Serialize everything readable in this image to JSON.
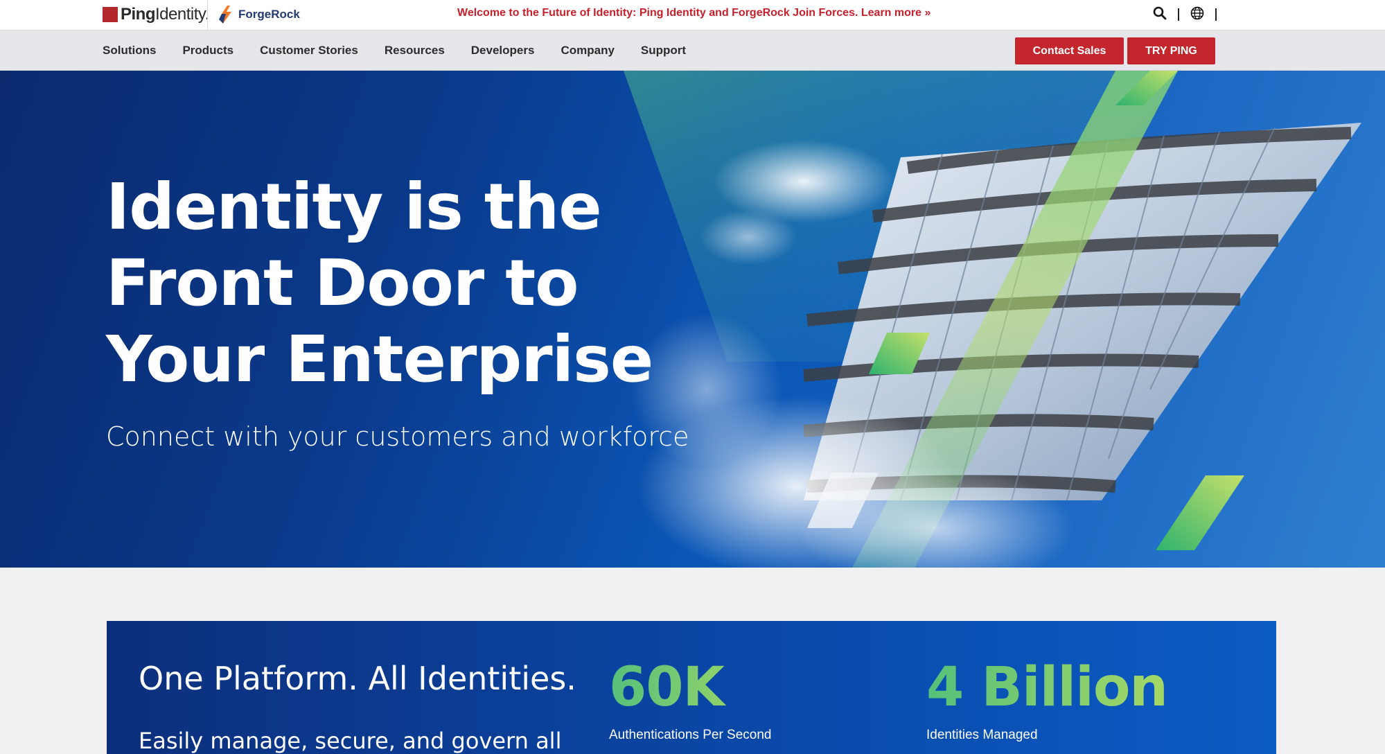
{
  "topbar": {
    "ping_logo_bold": "Ping",
    "ping_logo_light": "Identity.",
    "forgerock_logo": "ForgeRock",
    "announcement_text": "Welcome to the Future of Identity: Ping Identity and ForgeRock Join Forces.",
    "announcement_link": "Learn more »",
    "icons": [
      "search-icon",
      "globe-icon"
    ]
  },
  "nav": {
    "items": [
      {
        "label": "Solutions"
      },
      {
        "label": "Products"
      },
      {
        "label": "Customer Stories"
      },
      {
        "label": "Resources"
      },
      {
        "label": "Developers"
      },
      {
        "label": "Company"
      },
      {
        "label": "Support"
      }
    ],
    "contact_sales": "Contact Sales",
    "try_ping": "TRY PING"
  },
  "hero": {
    "title_line1": "Identity is the",
    "title_line2": "Front Door to",
    "title_line3": "Your Enterprise",
    "subtitle": "Connect with your customers and workforce"
  },
  "stats": {
    "heading": "One Platform. All Identities.",
    "description": "Easily manage, secure, and govern all",
    "items": [
      {
        "value": "60K",
        "label": "Authentications Per Second"
      },
      {
        "value": "4 Billion",
        "label": "Identities Managed"
      }
    ]
  },
  "colors": {
    "brand_red": "#c4262e",
    "hero_blue": "#0a3a8c",
    "stat_green": "#6cc771"
  }
}
